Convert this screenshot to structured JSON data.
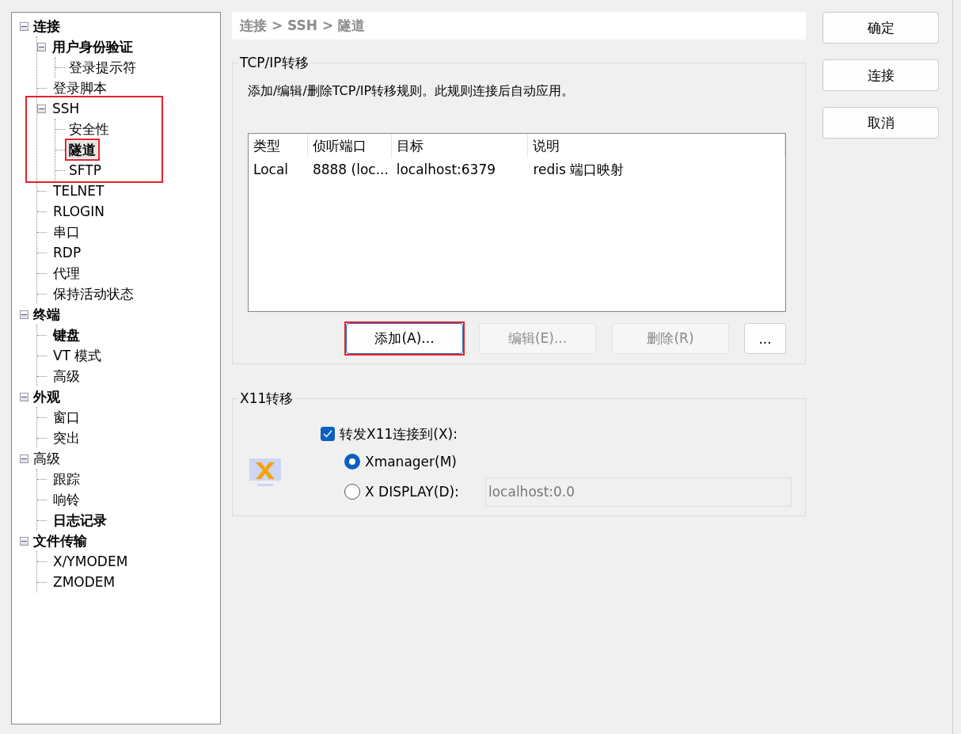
{
  "tree": [
    {
      "label": "连接",
      "bold": true,
      "expanded": true,
      "selected": false,
      "highlighted": false,
      "children": [
        {
          "label": "用户身份验证",
          "bold": true,
          "expanded": true,
          "selected": false,
          "highlighted": false,
          "children": [
            {
              "label": "登录提示符",
              "bold": false,
              "selected": false,
              "highlighted": false
            }
          ]
        },
        {
          "label": "登录脚本",
          "bold": false,
          "selected": false,
          "highlighted": false
        },
        {
          "label": "SSH",
          "bold": false,
          "expanded": true,
          "selected": false,
          "highlighted": true,
          "children": [
            {
              "label": "安全性",
              "bold": false,
              "selected": false,
              "highlighted": false
            },
            {
              "label": "隧道",
              "bold": true,
              "selected": true,
              "highlighted": true
            },
            {
              "label": "SFTP",
              "bold": false,
              "selected": false,
              "highlighted": false
            }
          ]
        },
        {
          "label": "TELNET",
          "bold": false,
          "selected": false,
          "highlighted": false
        },
        {
          "label": "RLOGIN",
          "bold": false,
          "selected": false,
          "highlighted": false
        },
        {
          "label": "串口",
          "bold": false,
          "selected": false,
          "highlighted": false
        },
        {
          "label": "RDP",
          "bold": false,
          "selected": false,
          "highlighted": false
        },
        {
          "label": "代理",
          "bold": false,
          "selected": false,
          "highlighted": false
        },
        {
          "label": "保持活动状态",
          "bold": false,
          "selected": false,
          "highlighted": false
        }
      ]
    },
    {
      "label": "终端",
      "bold": true,
      "expanded": true,
      "selected": false,
      "highlighted": false,
      "children": [
        {
          "label": "键盘",
          "bold": true,
          "selected": false,
          "highlighted": false
        },
        {
          "label": "VT 模式",
          "bold": false,
          "selected": false,
          "highlighted": false
        },
        {
          "label": "高级",
          "bold": false,
          "selected": false,
          "highlighted": false
        }
      ]
    },
    {
      "label": "外观",
      "bold": true,
      "expanded": true,
      "selected": false,
      "highlighted": false,
      "children": [
        {
          "label": "窗口",
          "bold": false,
          "selected": false,
          "highlighted": false
        },
        {
          "label": "突出",
          "bold": false,
          "selected": false,
          "highlighted": false
        }
      ]
    },
    {
      "label": "高级",
      "bold": false,
      "expanded": true,
      "selected": false,
      "highlighted": false,
      "children": [
        {
          "label": "跟踪",
          "bold": false,
          "selected": false,
          "highlighted": false
        },
        {
          "label": "响铃",
          "bold": false,
          "selected": false,
          "highlighted": false
        },
        {
          "label": "日志记录",
          "bold": true,
          "selected": false,
          "highlighted": false
        }
      ]
    },
    {
      "label": "文件传输",
      "bold": true,
      "expanded": true,
      "selected": false,
      "highlighted": false,
      "children": [
        {
          "label": "X/YMODEM",
          "bold": false,
          "selected": false,
          "highlighted": false
        },
        {
          "label": "ZMODEM",
          "bold": false,
          "selected": false,
          "highlighted": false
        }
      ]
    }
  ],
  "breadcrumb": "连接 > SSH > 隧道",
  "tcp_group": {
    "title": "TCP/IP转移",
    "description": "添加/编辑/删除TCP/IP转移规则。此规则连接后自动应用。",
    "table": {
      "columns": [
        "类型",
        "侦听端口",
        "目标",
        "说明"
      ],
      "rows": [
        [
          "Local",
          "8888 (loc...",
          "localhost:6379",
          "redis 端口映射"
        ]
      ]
    },
    "buttons": [
      {
        "label": "添加(A)...",
        "disabled": false,
        "highlighted": true
      },
      {
        "label": "编辑(E)...",
        "disabled": true,
        "highlighted": false
      },
      {
        "label": "删除(R)",
        "disabled": true,
        "highlighted": false
      },
      {
        "label": "...",
        "disabled": false,
        "highlighted": false
      }
    ]
  },
  "x11_group": {
    "title": "X11转移",
    "forward": {
      "label": "转发X11连接到(X):",
      "checked": true
    },
    "options": [
      {
        "label": "Xmanager(M)",
        "selected": true
      },
      {
        "label": "X DISPLAY(D):",
        "selected": false
      }
    ],
    "display_field": {
      "value": "localhost:0.0",
      "disabled": true
    }
  },
  "dialog_buttons": [
    "确定",
    "连接",
    "取消"
  ]
}
